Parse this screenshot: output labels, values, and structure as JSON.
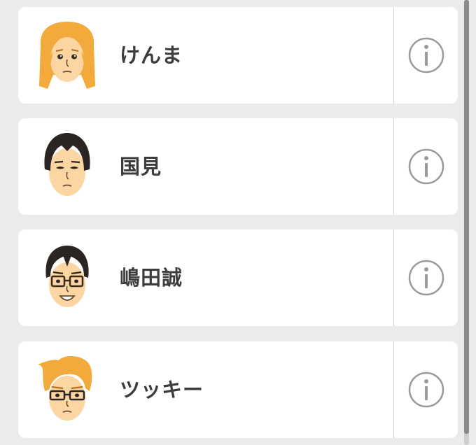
{
  "mii_list": {
    "items": [
      {
        "name": "けんま",
        "avatar_icon": "blonde-long-hair-mii-avatar-icon",
        "info_icon": "info-icon"
      },
      {
        "name": "国見",
        "avatar_icon": "dark-bob-hair-mii-avatar-icon",
        "info_icon": "info-icon"
      },
      {
        "name": "嶋田誠",
        "avatar_icon": "dark-hair-glasses-mii-avatar-icon",
        "info_icon": "info-icon"
      },
      {
        "name": "ツッキー",
        "avatar_icon": "blonde-spiky-hair-glasses-mii-avatar-icon",
        "info_icon": "info-icon"
      }
    ]
  },
  "colors": {
    "background": "#ebebeb",
    "card": "#ffffff",
    "name_text": "#3c3c3c",
    "info_icon": "#9a9a9a",
    "scroll_thumb": "#8a8a8a"
  }
}
